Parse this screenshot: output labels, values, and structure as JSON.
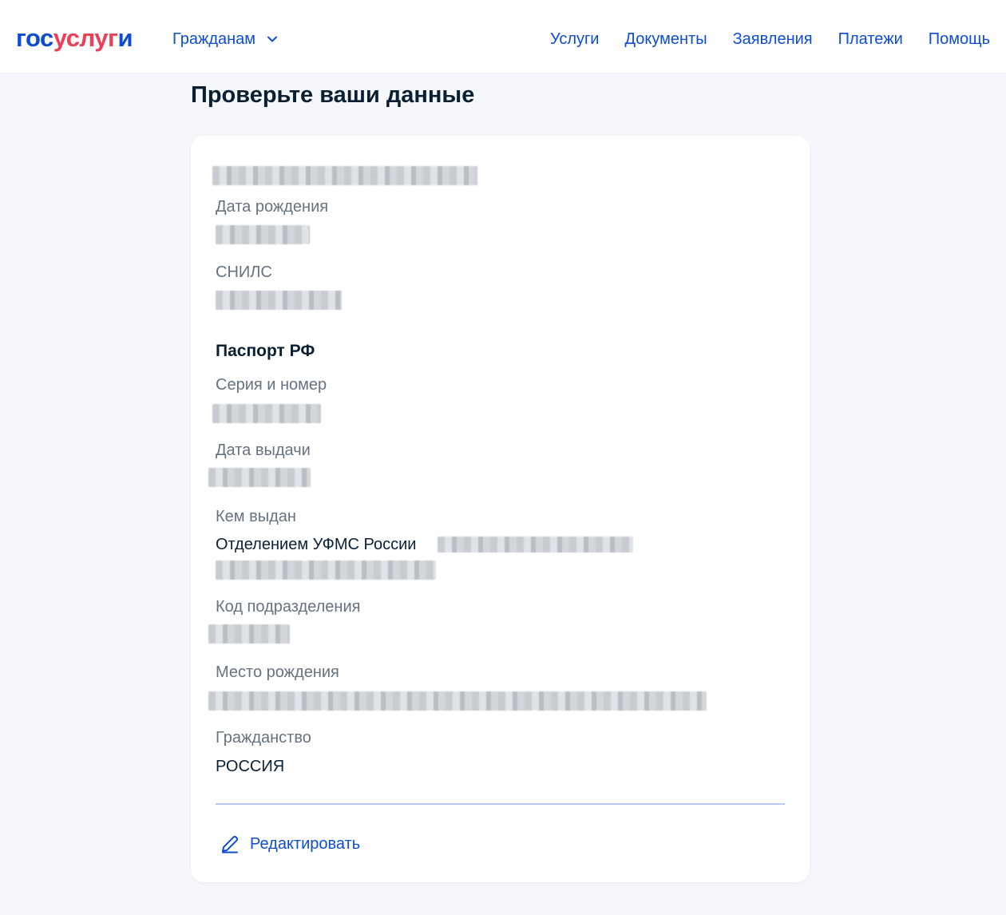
{
  "header": {
    "logo": {
      "part1": "гос",
      "part2": "услуг",
      "part3": "и"
    },
    "audience": "Гражданам",
    "nav": [
      "Услуги",
      "Документы",
      "Заявления",
      "Платежи",
      "Помощь"
    ]
  },
  "page": {
    "title": "Проверьте ваши данные"
  },
  "card": {
    "birth_date_label": "Дата рождения",
    "snils_label": "СНИЛС",
    "passport_section": "Паспорт РФ",
    "series_label": "Серия и номер",
    "issue_date_label": "Дата выдачи",
    "issued_by_label": "Кем выдан",
    "issued_by_value": "Отделением УФМС России",
    "code_label": "Код подразделения",
    "birth_place_label": "Место рождения",
    "citizenship_label": "Гражданство",
    "citizenship_value": "РОССИЯ",
    "edit_label": "Редактировать"
  },
  "colors": {
    "brand_blue": "#0d4cd3",
    "brand_red": "#ee3f58",
    "background": "#f5f7fb",
    "text": "#0b1f33",
    "muted": "#66727f"
  },
  "icons": {
    "chevron": "chevron-down-icon",
    "edit": "pencil-icon"
  }
}
